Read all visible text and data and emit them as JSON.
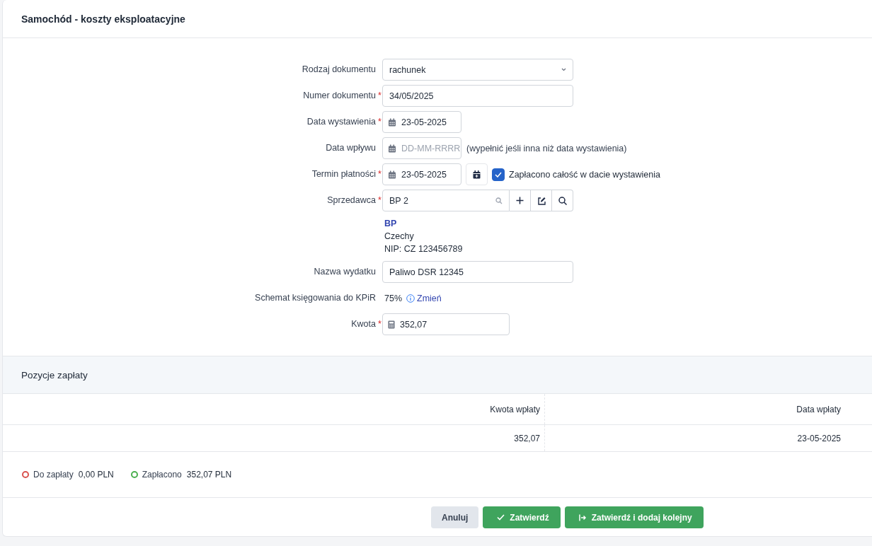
{
  "header": {
    "title": "Samochód - koszty eksploatacyjne"
  },
  "form": {
    "rows": [
      {
        "kind": "select",
        "label": "Rodzaj dokumentu",
        "value": "rachunek"
      },
      {
        "kind": "text",
        "label": "Numer dokumentu",
        "required_mark": "*",
        "value": "34/05/2025"
      },
      {
        "kind": "date",
        "label": "Data wystawienia",
        "required_mark": "*",
        "value": "23-05-2025"
      },
      {
        "kind": "date",
        "label": "Data wpływu",
        "placeholder": "DD-MM-RRRR",
        "hint": "(wypełnić jeśli inna niż data wystawienia)"
      },
      {
        "kind": "date",
        "label": "Termin płatności",
        "required_mark": "*",
        "value": "23-05-2025",
        "toggle": {
          "checked": true,
          "label": "Zapłacono całość w dacie wystawienia"
        }
      },
      {
        "kind": "seller",
        "label": "Sprzedawca",
        "required_mark": "*",
        "value": "BP 2",
        "info": {
          "name": "BP",
          "lines": [
            "Czechy",
            "NIP: CZ 123456789"
          ]
        }
      },
      {
        "kind": "text",
        "label": "Nazwa wydatku",
        "value": "Paliwo DSR 12345"
      },
      {
        "kind": "scheme",
        "label": "Schemat księgowania do KPiR",
        "value": "75%",
        "link": "Zmień"
      },
      {
        "kind": "amount",
        "label": "Kwota",
        "required_mark": "*",
        "value": "352,07"
      }
    ]
  },
  "payments": {
    "title": "Pozycje zapłaty",
    "columns": [
      "Kwota wpłaty",
      "Data wpłaty"
    ],
    "rows": [
      [
        "352,07",
        "23-05-2025"
      ]
    ]
  },
  "summary": [
    {
      "label": "Do zapłaty",
      "amount": "0,00 PLN",
      "color": "#d9534f"
    },
    {
      "label": "Zapłacono",
      "amount": "352,07 PLN",
      "color": "#4caf50"
    }
  ],
  "buttons": [
    {
      "kind": "cancel",
      "label": "Anuluj"
    },
    {
      "kind": "confirm",
      "label": "Zatwierdź"
    },
    {
      "kind": "confirm_next",
      "label": "Zatwierdź i dodaj kolejny"
    }
  ]
}
